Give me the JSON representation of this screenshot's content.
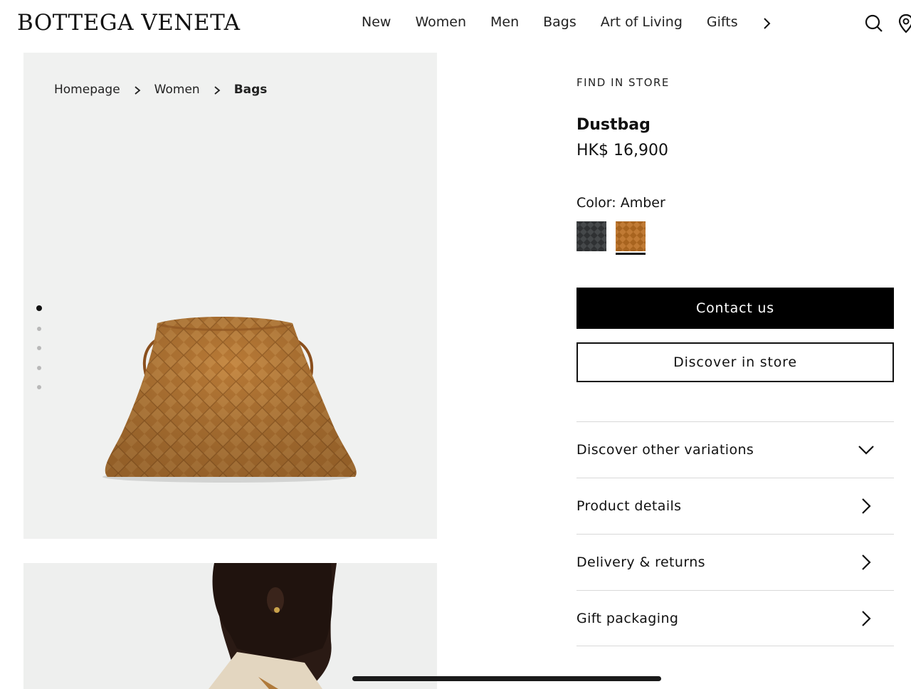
{
  "header": {
    "logo": "BOTTEGA VENETA",
    "nav": [
      "New",
      "Women",
      "Men",
      "Bags",
      "Art of Living",
      "Gifts"
    ]
  },
  "breadcrumb": {
    "items": [
      "Homepage",
      "Women"
    ],
    "current": "Bags"
  },
  "gallery": {
    "image_count": 5,
    "active_index": 0
  },
  "product": {
    "eyebrow": "FIND IN STORE",
    "name": "Dustbag",
    "price": "HK$ 16,900",
    "color_label": "Color: Amber",
    "swatches": [
      {
        "name": "black",
        "color": "#2f3133"
      },
      {
        "name": "amber",
        "color": "#a8641f",
        "selected": true
      }
    ]
  },
  "actions": {
    "primary": "Contact us",
    "secondary": "Discover in store"
  },
  "accordion": [
    {
      "label": "Discover other variations",
      "icon": "chevron-down-icon"
    },
    {
      "label": "Product details",
      "icon": "chevron-right-icon"
    },
    {
      "label": "Delivery & returns",
      "icon": "chevron-right-icon"
    },
    {
      "label": "Gift packaging",
      "icon": "chevron-right-icon"
    }
  ],
  "colors": {
    "text": "#111111",
    "gallery_bg": "#f0f1f0",
    "button_bg": "#000000",
    "divider": "#d9d9d9",
    "bag_amber": "#b97a36"
  }
}
